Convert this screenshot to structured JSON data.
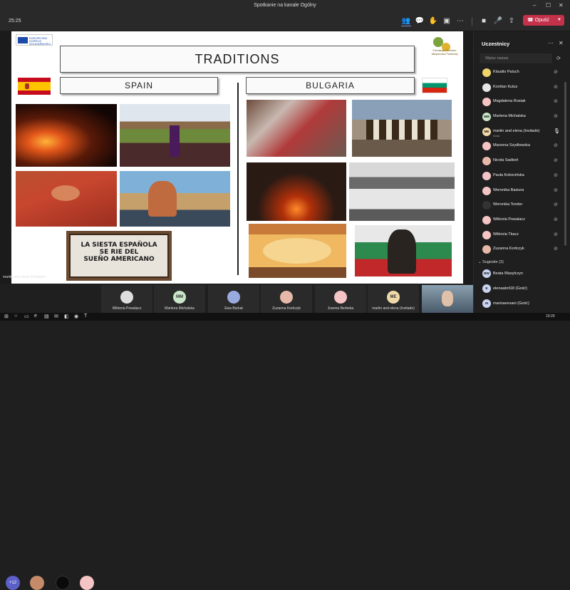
{
  "window": {
    "title": "Spotkanie na kanale Ogólny"
  },
  "toolbar": {
    "timer": "25:25",
    "leave_label": "Opuść"
  },
  "slide": {
    "eu_logo_text": "EUROPEJSKI KORPUS SOLIDARNOŚCI",
    "right_logo_text": "Fundacja Centrum Aktywności Twórczej",
    "title": "TRADITIONS",
    "left_country": "SPAIN",
    "right_country": "BULGARIA",
    "siesta_text": [
      "LA SIESTA ESPAÑOLA",
      "SE RIE DEL",
      "SUEÑO AMERICANO"
    ],
    "presenter_label": "martin and elena (Invitado)"
  },
  "panel": {
    "header": "Uczestnicy",
    "search_placeholder": "Wpisz nazwę",
    "participants": [
      {
        "name": "Klaudio Paluch",
        "color": "#f0d36b",
        "initials": ""
      },
      {
        "name": "Kordian Kulus",
        "color": "#e6e6e6",
        "initials": ""
      },
      {
        "name": "Magdalena Rosiak",
        "color": "#f5c4c4",
        "initials": ""
      },
      {
        "name": "Marlena Michalska",
        "color": "#c9e6c9",
        "initials": "MM"
      },
      {
        "name": "martin and elena (Invitado)",
        "sub": "Gość",
        "color": "#f0d9a8",
        "initials": "ME",
        "active": true
      },
      {
        "name": "Marzena Szydlewska",
        "color": "#f5c4c4",
        "initials": ""
      },
      {
        "name": "Nicola Sadkoń",
        "color": "#e6b8a8",
        "initials": ""
      },
      {
        "name": "Paula Kokocińska",
        "color": "#f5c4c4",
        "initials": ""
      },
      {
        "name": "Weronika Basiura",
        "color": "#f5c4c4",
        "initials": ""
      },
      {
        "name": "Weronika Tonder",
        "color": "#333333",
        "initials": ""
      },
      {
        "name": "Wiktoria Powalacz",
        "color": "#f5c4c4",
        "initials": ""
      },
      {
        "name": "Wiktoria Tkacz",
        "color": "#f5c4c4",
        "initials": ""
      },
      {
        "name": "Zuzanna Korłczyk",
        "color": "#e6b8a8",
        "initials": ""
      }
    ],
    "suggestions_label": "Sugestie (3)",
    "suggestions": [
      {
        "name": "Beata Wasylczyn",
        "initials": "BW"
      },
      {
        "name": "elenaabril18 (Gość)",
        "initials": "E"
      },
      {
        "name": "marioavesani (Gość)",
        "initials": "M"
      }
    ]
  },
  "strip": {
    "more": "+12",
    "tiles": [
      {
        "name": "Wiktoria Powalacz",
        "initials": "",
        "color": "#ddd"
      },
      {
        "name": "Marlena Michalska",
        "initials": "MM",
        "color": "#c9e6c9"
      },
      {
        "name": "Ewa Burkat",
        "initials": "",
        "color": "#9ad"
      },
      {
        "name": "Zuzanna Korłczyk",
        "initials": "",
        "color": "#e6b8a8"
      },
      {
        "name": "Joanna Berbeka",
        "initials": "",
        "color": "#f5c4c4"
      },
      {
        "name": "martin and elena (Invitado)",
        "initials": "ME",
        "color": "#f0d9a8"
      }
    ]
  },
  "taskbar": {
    "clock": "19:29"
  }
}
